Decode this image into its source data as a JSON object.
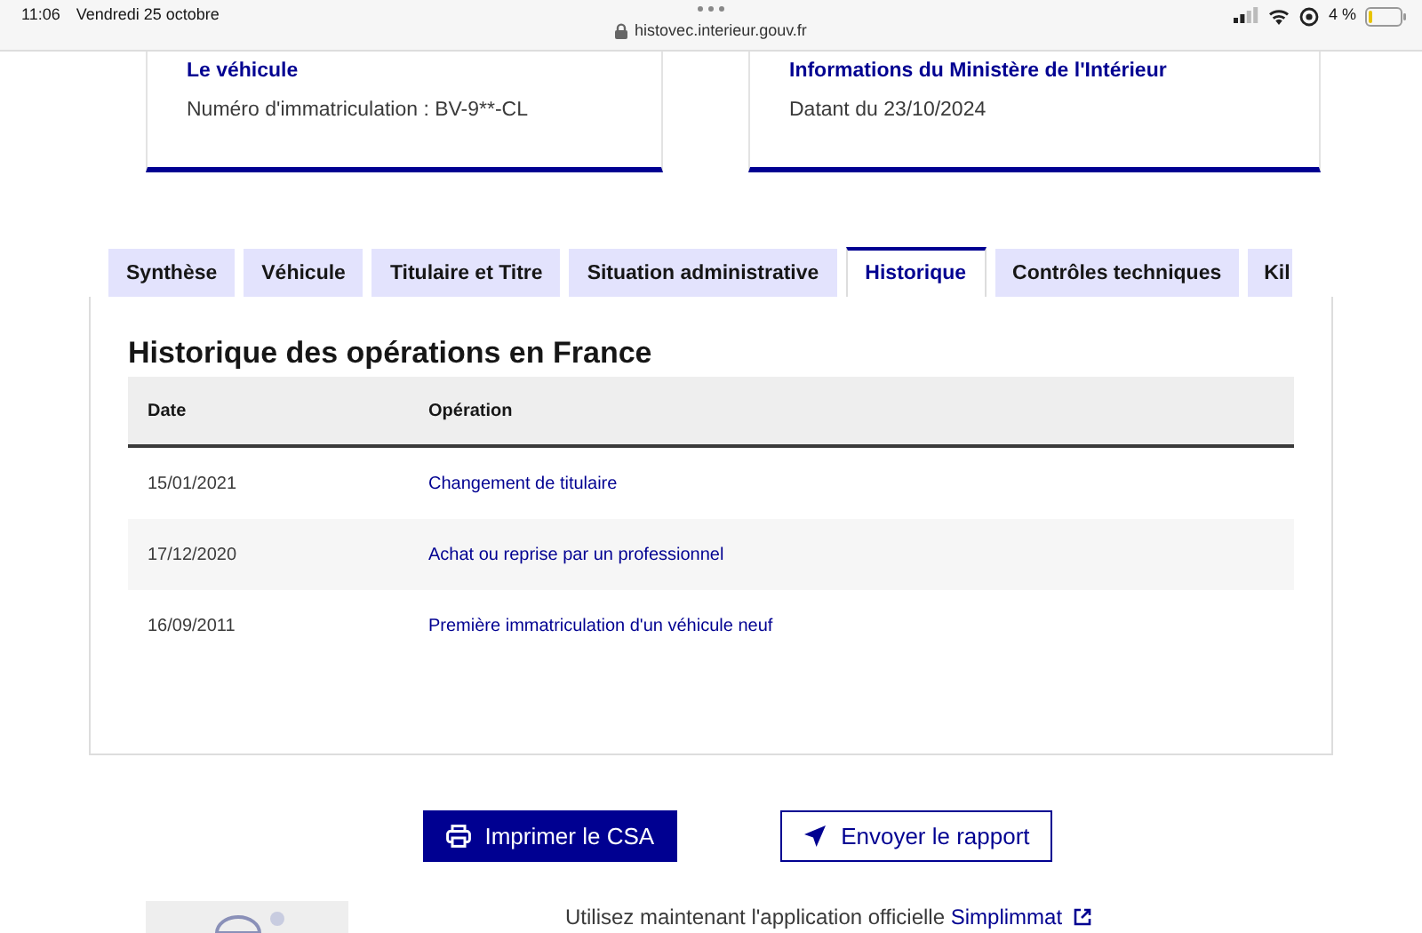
{
  "status_bar": {
    "time": "11:06",
    "date": "Vendredi 25 octobre",
    "url": "histovec.interieur.gouv.fr",
    "battery": "4 %"
  },
  "cards": [
    {
      "title": "Le véhicule",
      "text": "Numéro d'immatriculation : BV-9**-CL"
    },
    {
      "title": "Informations du Ministère de l'Intérieur",
      "text": "Datant du 23/10/2024"
    }
  ],
  "tabs": [
    {
      "label": "Synthèse",
      "selected": false
    },
    {
      "label": "Véhicule",
      "selected": false
    },
    {
      "label": "Titulaire et Titre",
      "selected": false
    },
    {
      "label": "Situation administrative",
      "selected": false
    },
    {
      "label": "Historique",
      "selected": true
    },
    {
      "label": "Contrôles techniques",
      "selected": false
    },
    {
      "label": "Kil",
      "selected": false
    }
  ],
  "panel": {
    "heading": "Historique des opérations en France",
    "columns": [
      "Date",
      "Opération"
    ],
    "rows": [
      {
        "date": "15/01/2021",
        "operation": "Changement de titulaire"
      },
      {
        "date": "17/12/2020",
        "operation": "Achat ou reprise par un professionnel"
      },
      {
        "date": "16/09/2011",
        "operation": "Première immatriculation d'un véhicule neuf"
      }
    ]
  },
  "buttons": [
    {
      "label": "Imprimer le CSA",
      "kind": "primary"
    },
    {
      "label": "Envoyer le rapport",
      "kind": "secondary"
    }
  ],
  "footer": {
    "text": "Utilisez maintenant l'application officielle",
    "link": "Simplimmat"
  }
}
